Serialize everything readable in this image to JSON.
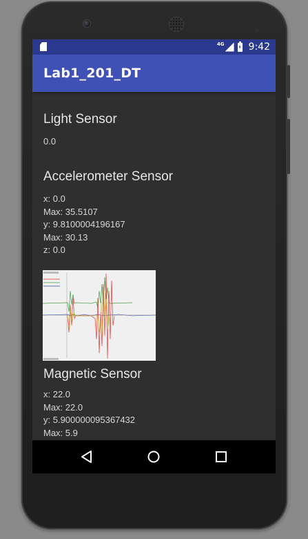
{
  "status_bar": {
    "network_label": "4G",
    "time": "9:42",
    "icons": [
      "sd-card-icon",
      "signal-icon",
      "battery-charging-icon"
    ]
  },
  "app_bar": {
    "title": "Lab1_201_DT"
  },
  "light_sensor": {
    "title": "Light Sensor",
    "value": "0.0"
  },
  "accelerometer_sensor": {
    "title": "Accelerometer Sensor",
    "lines": [
      "x: 0.0",
      "Max: 35.5107",
      "y: 9.8100004196167",
      "Max: 30.13",
      "z: 0.0"
    ]
  },
  "magnetic_sensor": {
    "title": "Magnetic Sensor",
    "lines": [
      "x: 22.0",
      "Max: 22.0",
      "y: 5.900000095367432",
      "Max: 5.9"
    ]
  },
  "graph": {
    "background": "#f0f0f0",
    "series_colors": [
      "#e53935",
      "#43a047",
      "#3949ab"
    ]
  },
  "nav_bar": {
    "buttons": [
      "back-icon",
      "home-icon",
      "recents-icon"
    ]
  }
}
